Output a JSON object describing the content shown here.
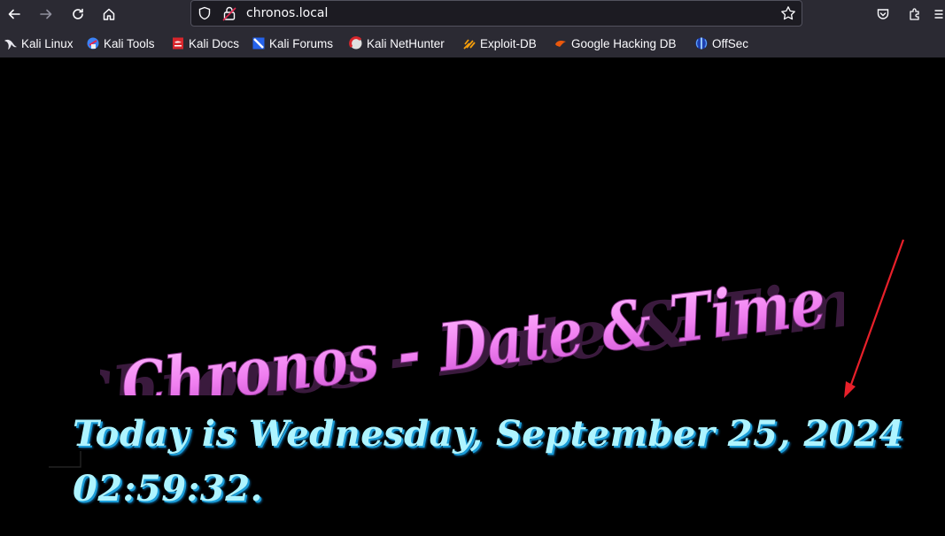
{
  "browser": {
    "url": "chronos.local",
    "bookmarks": [
      {
        "label": "Kali Linux",
        "icon": "kali-dragon-icon"
      },
      {
        "label": "Kali Tools",
        "icon": "kali-tools-icon"
      },
      {
        "label": "Kali Docs",
        "icon": "kali-docs-icon"
      },
      {
        "label": "Kali Forums",
        "icon": "kali-forums-icon"
      },
      {
        "label": "Kali NetHunter",
        "icon": "nethunter-icon"
      },
      {
        "label": "Exploit-DB",
        "icon": "exploit-db-icon"
      },
      {
        "label": "Google Hacking DB",
        "icon": "ghdb-icon"
      },
      {
        "label": "OffSec",
        "icon": "offsec-icon"
      }
    ]
  },
  "page": {
    "heading": "Chronos - Date & Time",
    "date_line": "Today is Wednesday, September 25, 2024",
    "time_line": "02:59:32.",
    "heading_color": "#f07ff0",
    "text_color": "#aef4ff",
    "annotation_color": "#e8202a"
  }
}
